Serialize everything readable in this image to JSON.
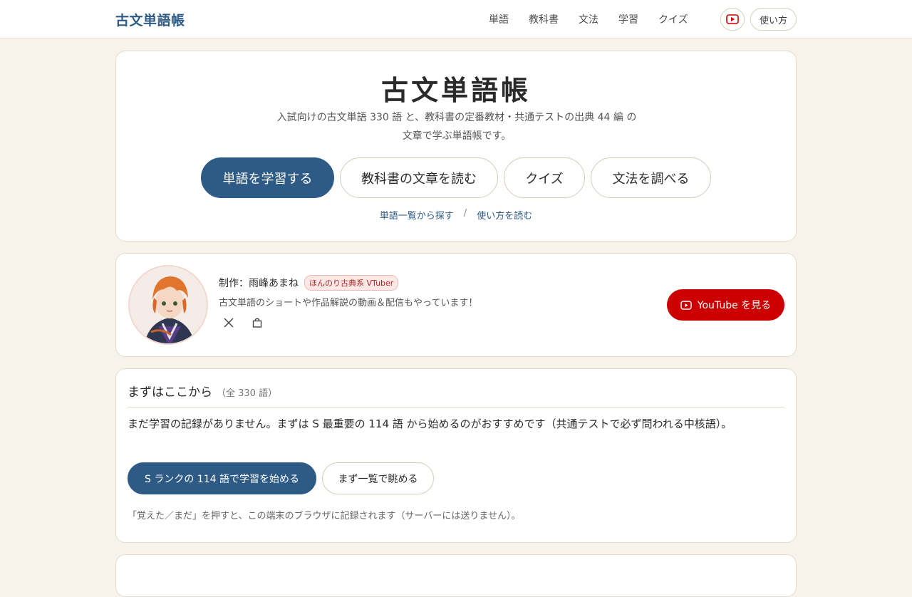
{
  "header": {
    "brand": "古文単語帳",
    "nav": [
      "単語",
      "教科書",
      "文法",
      "学習",
      "クイズ"
    ],
    "youtube_icon": "youtube-icon",
    "howto_label": "使い方"
  },
  "hero": {
    "title": "古文単語帳",
    "description": "入試向けの古文単語 330 語 と、教科書の定番教材・共通テストの出典 44 編 の文章で学ぶ単語帳です。",
    "buttons": [
      "単語を学習する",
      "教科書の文章を読む",
      "クイズ",
      "文法を調べる"
    ],
    "link_list": "単語一覧から探す",
    "link_sep": "/",
    "link_howto": "使い方を読む"
  },
  "creator": {
    "name": "制作：雨峰あまね",
    "tag": "ほんのり古典系 VTuber",
    "description": "古文単語のショートや作品解説の動画＆配信もやっています！",
    "icons": [
      "x-icon",
      "shop-bag-icon"
    ],
    "youtube_button": "YouTube を見る"
  },
  "start": {
    "heading": "まずはここから",
    "count": "（全 330 語）",
    "body": "まだ学習の記録がありません。まずは S 最重要の 114 語 から始めるのがおすすめです（共通テストで必ず問われる中核語）。",
    "primary_button": "S ランクの 114 語で学習を始める",
    "secondary_button": "まず一覧で眺める",
    "note": "「覚えた／まだ」を押すと、この端末のブラウザに記録されます（サーバーには送りません）。"
  },
  "colors": {
    "accent": "#2e5b86",
    "youtube": "#cc0000",
    "background": "#f7f3ea"
  }
}
